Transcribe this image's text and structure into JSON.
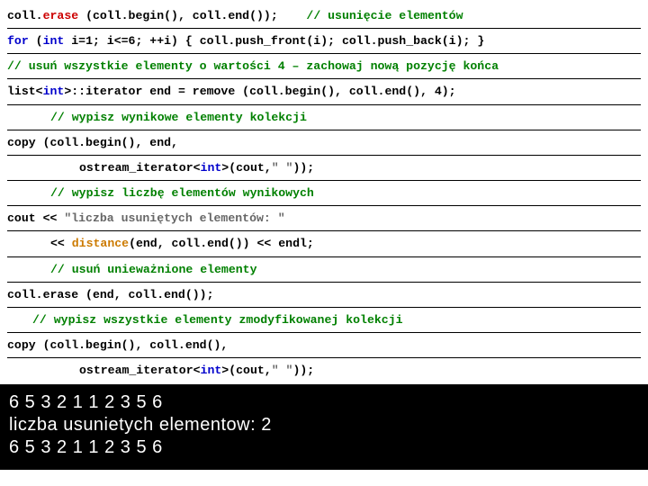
{
  "code": {
    "l1a": "coll.",
    "l1b": "erase",
    "l1c": " (coll.begin(), coll.end());    ",
    "l1d": "// usunięcie elementów",
    "l2a": "for",
    "l2b": " (",
    "l2c": "int",
    "l2d": " i=1; i<=6; ++i) { coll.push_front(i); coll.push_back(i); }",
    "l3": "// usuń wszystkie elementy o wartości 4 – zachowaj nową pozycję końca",
    "l4a": "list<",
    "l4b": "int",
    "l4c": ">::iterator end = remove (coll.begin(), coll.end(), 4);",
    "l5": "// wypisz wynikowe elementy kolekcji",
    "l6": "copy (coll.begin(), end,",
    "l7a": "ostream_iterator<",
    "l7b": "int",
    "l7c": ">(cout,",
    "l7d": "\" \"",
    "l7e": "));",
    "l8": "// wypisz liczbę elementów wynikowych",
    "l9a": "cout << ",
    "l9b": "\"liczba usuniętych elementów: \"",
    "l10a": "<< ",
    "l10b": "distance",
    "l10c": "(end, coll.end()) << endl;",
    "l11": "// usuń unieważnione elementy",
    "l12": "coll.erase (end, coll.end());",
    "l13": "// wypisz wszystkie elementy zmodyfikowanej kolekcji",
    "l14": "copy (coll.begin(), coll.end(),",
    "l15a": "ostream_iterator<",
    "l15b": "int",
    "l15c": ">(cout,",
    "l15d": "\" \"",
    "l15e": "));"
  },
  "output": {
    "o1": "6 5 3 2 1 1 2  3 5 6",
    "o2": "liczba usunietych elementow: 2",
    "o3": "6 5 3 2 1 1 2 3 5 6"
  }
}
